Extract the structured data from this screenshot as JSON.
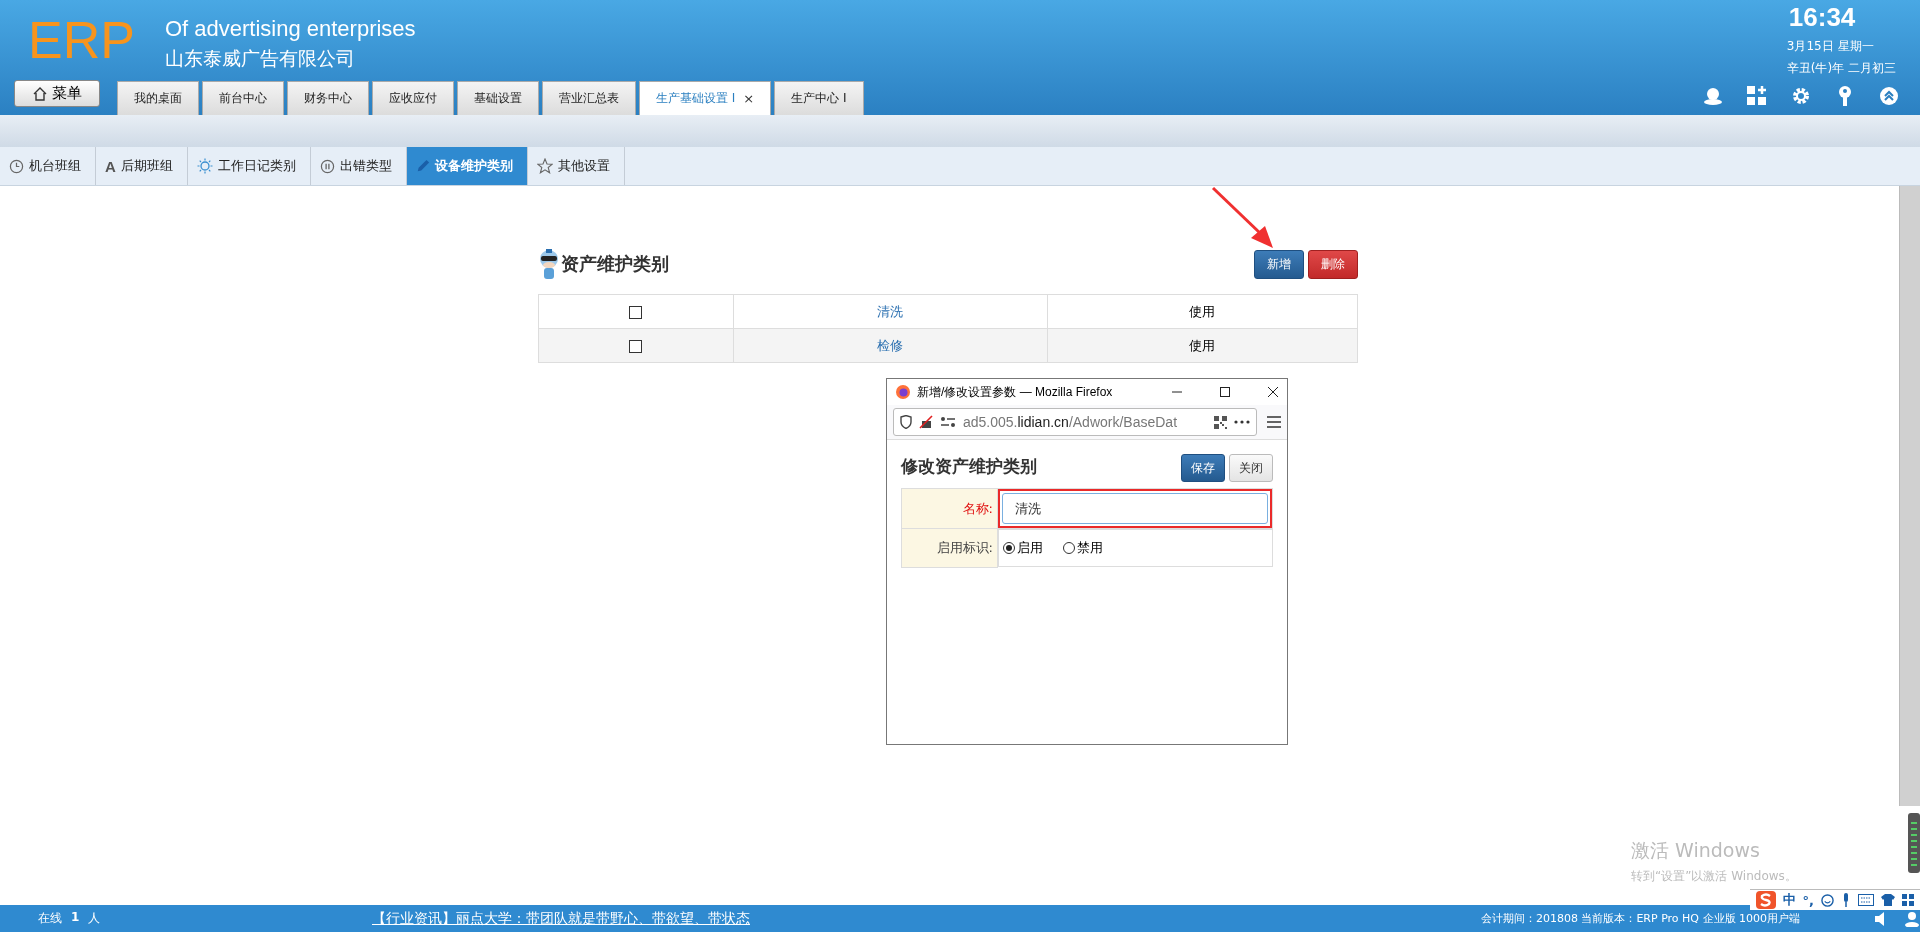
{
  "header": {
    "logo": "ERP",
    "tagline": "Of advertising enterprises",
    "company": "山东泰威广告有限公司",
    "menu_button": "菜单",
    "tabs": [
      {
        "label": "我的桌面",
        "selected": false
      },
      {
        "label": "前台中心",
        "selected": false
      },
      {
        "label": "财务中心",
        "selected": false
      },
      {
        "label": "应收应付",
        "selected": false
      },
      {
        "label": "基础设置",
        "selected": false
      },
      {
        "label": "营业汇总表",
        "selected": false
      },
      {
        "label": "生产基础设置 I",
        "selected": true,
        "close": "×"
      },
      {
        "label": "生产中心 I",
        "selected": false
      }
    ],
    "clock": {
      "time": "16:34",
      "date": "3月15日 星期一",
      "lunar": "辛丑(牛)年 二月初三"
    }
  },
  "subtabs": [
    {
      "label": "机台班组",
      "kind": "clock",
      "selected": false
    },
    {
      "label": "后期班组",
      "kind": "letter",
      "glyph": "A",
      "selected": false
    },
    {
      "label": "工作日记类别",
      "kind": "sun",
      "selected": false
    },
    {
      "label": "出错类型",
      "kind": "pause",
      "selected": false
    },
    {
      "label": "设备维护类别",
      "kind": "pen",
      "selected": true
    },
    {
      "label": "其他设置",
      "kind": "star",
      "selected": false
    }
  ],
  "panel": {
    "title": "资产维护类别",
    "buttons": [
      {
        "label": "新增",
        "kind": "primary"
      },
      {
        "label": "删除",
        "kind": "danger"
      }
    ],
    "rows": [
      {
        "checked": false,
        "name": "清洗",
        "status": "使用"
      },
      {
        "checked": false,
        "name": "检修",
        "status": "使用"
      }
    ]
  },
  "popup": {
    "title": "新增/修改设置参数 — Mozilla Firefox",
    "url": "ad5.005.**lidian.cn**/Adwork/BaseDat",
    "heading": "修改资产维护类别",
    "buttons": [
      {
        "label": "保存",
        "kind": "primary"
      },
      {
        "label": "关闭",
        "kind": "default"
      }
    ],
    "name_field": {
      "label": "名称:",
      "value": "清洗",
      "required": true,
      "highlighted": true
    },
    "status_field": {
      "label": "启用标识:",
      "options": [
        {
          "label": "启用",
          "selected": true
        },
        {
          "label": "禁用",
          "selected": false
        }
      ]
    }
  },
  "watermark_os": {
    "title": "激活 Windows",
    "hint": "转到“设置”以激活 Windows。"
  },
  "ime": {
    "mode": "中",
    "punct": "°,"
  },
  "status_bar": {
    "online_label": "在线",
    "online_count": "1",
    "online_unit": "人",
    "news": "【行业资讯】丽点大学：带团队就是带野心、带欲望、带状态",
    "info": "会计期间：201808 当前版本：ERP Pro HQ 企业版 1000用户端"
  }
}
